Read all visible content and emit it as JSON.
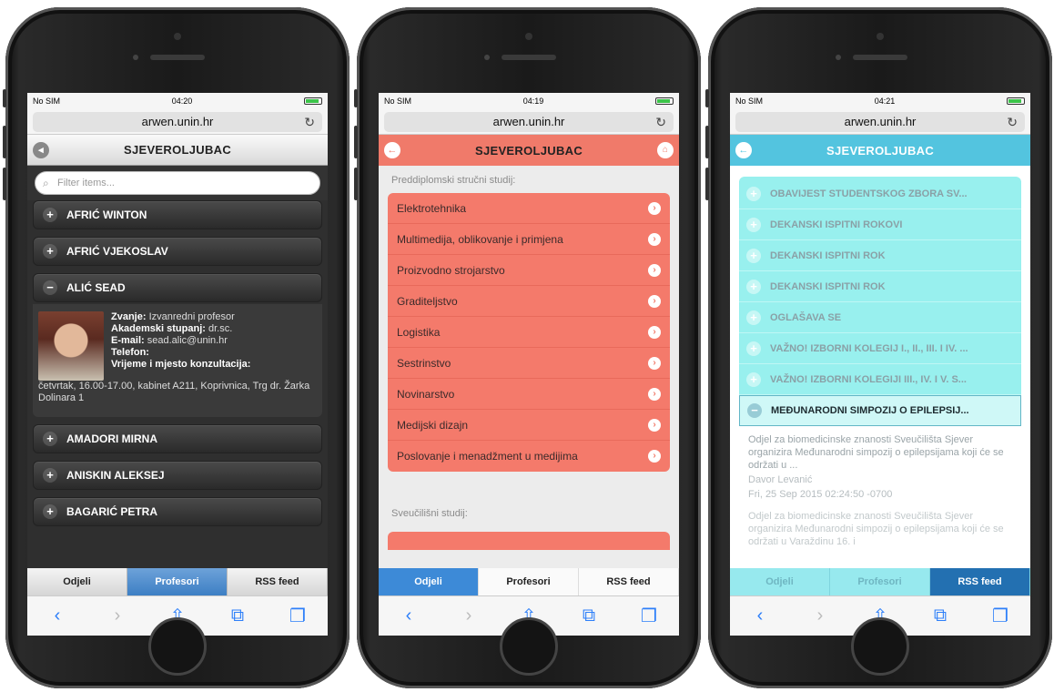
{
  "device": {
    "carrier": "No SIM",
    "url": "arwen.unin.hr",
    "app_title": "SJEVEROLJUBAC"
  },
  "phone1": {
    "time": "04:20",
    "filter_placeholder": "Filter items...",
    "professors": [
      {
        "sign": "+",
        "name": "AFRIĆ WINTON"
      },
      {
        "sign": "+",
        "name": "AFRIĆ VJEKOSLAV"
      },
      {
        "sign": "−",
        "name": "ALIĆ SEAD"
      }
    ],
    "details": {
      "zvanje_label": "Zvanje:",
      "zvanje_value": "Izvanredni profesor",
      "akademski_label": "Akademski stupanj:",
      "akademski_value": "dr.sc.",
      "email_label": "E-mail:",
      "email_value": "sead.alic@unin.hr",
      "telefon_label": "Telefon:",
      "vrijeme_label": "Vrijeme i mjesto konzultacija:",
      "vrijeme_value": "četvrtak, 16.00-17.00, kabinet A211, Koprivnica, Trg dr. Žarka Dolinara 1"
    },
    "professors_after": [
      {
        "sign": "+",
        "name": "AMADORI MIRNA"
      },
      {
        "sign": "+",
        "name": "ANISKIN ALEKSEJ"
      },
      {
        "sign": "+",
        "name": "BAGARIĆ PETRA"
      }
    ],
    "tabs": [
      "Odjeli",
      "Profesori",
      "RSS feed"
    ],
    "active_tab": 1
  },
  "phone2": {
    "time": "04:19",
    "section1_label": "Preddiplomski stručni studij:",
    "departments": [
      "Elektrotehnika",
      "Multimedija, oblikovanje i primjena",
      "Proizvodno strojarstvo",
      "Graditeljstvo",
      "Logistika",
      "Sestrinstvo",
      "Novinarstvo",
      "Medijski dizajn",
      "Poslovanje i menadžment u medijima"
    ],
    "section2_label": "Sveučilišni studij:",
    "tabs": [
      "Odjeli",
      "Profesori",
      "RSS feed"
    ],
    "active_tab": 0
  },
  "phone3": {
    "time": "04:21",
    "feed_items": [
      "OBAVIJEST STUDENTSKOG ZBORA SV...",
      "DEKANSKI ISPITNI ROKOVI",
      "DEKANSKI ISPITNI ROK",
      "DEKANSKI ISPITNI ROK",
      "OGLAŠAVA SE",
      "VAŽNO! IZBORNI KOLEGIJ I., II., III. I IV. ...",
      "VAŽNO! IZBORNI KOLEGIJI III., IV. I V. S..."
    ],
    "open_item": "MEĐUNARODNI SIMPOZIJ O EPILEPSIJ...",
    "open_body_1": "Odjel za biomedicinske znanosti Sveučilišta Sjever organizira Međunarodni simpozij o epilepsijama koji će se održati u ...",
    "open_author": "Davor Levanić",
    "open_date": "Fri, 25 Sep 2015 02:24:50 -0700",
    "open_body_2": "Odjel za biomedicinske znanosti Sveučilišta Sjever organizira Međunarodni simpozij o epilepsijama koji će se održati u Varaždinu 16. i",
    "tabs": [
      "Odjeli",
      "Profesori",
      "RSS feed"
    ],
    "active_tab": 2
  },
  "icons": {
    "back": "back-arrow-icon",
    "home": "home-icon",
    "reload": "reload-icon",
    "search": "search-icon",
    "share": "share-icon",
    "bookmarks": "book-icon",
    "tabs": "tabs-icon"
  },
  "colors": {
    "phone1_accent": "#3d7fc4",
    "phone2_accent": "#f07a6a",
    "phone3_accent": "#53c4df"
  }
}
